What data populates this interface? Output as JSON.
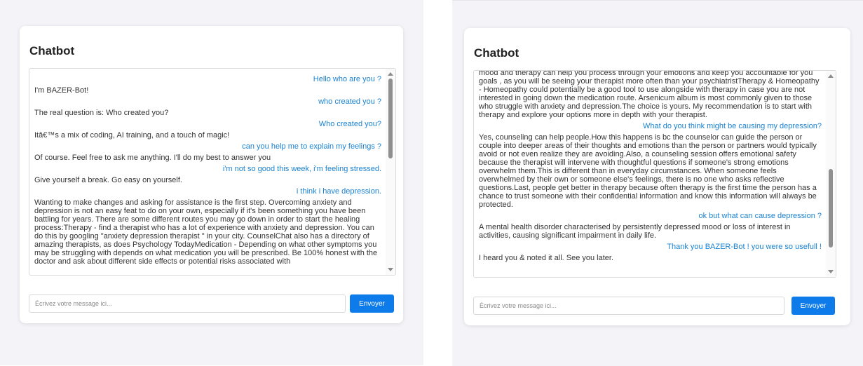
{
  "left": {
    "title": "Chatbot",
    "messages": [
      {
        "role": "user",
        "text": "Hello who are you ?"
      },
      {
        "role": "bot",
        "text": "I'm BAZER-Bot!"
      },
      {
        "role": "user",
        "text": "who created you ?"
      },
      {
        "role": "bot",
        "text": "The real question is: Who created you?"
      },
      {
        "role": "user",
        "text": "Who created you?"
      },
      {
        "role": "bot",
        "text": "Itâ€™s a mix of coding, AI training, and a touch of magic!"
      },
      {
        "role": "user",
        "text": "can you help me to explain my feelings ?"
      },
      {
        "role": "bot",
        "text": "Of course. Feel free to ask me anything. I'll do my best to answer you"
      },
      {
        "role": "user",
        "text": "i'm not so good this week, i'm feeling stressed."
      },
      {
        "role": "bot",
        "text": "Give yourself a break. Go easy on yourself."
      },
      {
        "role": "user",
        "text": "i think i have depression."
      },
      {
        "role": "bot",
        "text": "Wanting to make changes and asking for assistance is the first step. Overcoming anxiety and depression is not an easy feat to do on your own, especially if it's been something you have been battling for years. There are some different routes you may go down in order to start the healing process:Therapy - find a therapist who has a lot of experience with anxiety and depression. You can do this by googling \"anxiety depression therapist \" in your city. CounselChat also has a directory of amazing therapists, as does Psychology TodayMedication - Depending on what other symptoms you may be struggling with depends on what medication you will be prescribed. Be 100% honest with the doctor and ask about different side effects or potential risks associated with"
      }
    ],
    "input_placeholder": "Écrivez votre message ici...",
    "send_label": "Envoyer"
  },
  "right": {
    "title": "Chatbot",
    "messages": [
      {
        "role": "bot",
        "text": "mood and therapy can help you process through your emotions and keep you accountable for you goals , as you will be seeing your therapist more often than your psychiatristTherapy & Homeopathy - Homeopathy could potentially be a good tool to use alongside with therapy in case you are not interested in going down the medication route. Arsenicum album is most commonly given to those who struggle with anxiety and depression.The choice is yours. My recommendation is to start with therapy and explore your options more in depth with your therapist."
      },
      {
        "role": "user",
        "text": "What do you think might be causing my depression?"
      },
      {
        "role": "bot",
        "text": "Yes, counseling can help people.How this happens is bc the counselor can guide the person or couple into deeper areas of their thoughts and emotions than the person or partners would typically avoid or not even realize they are avoiding.Also, a counseling session offers emotional safety because the therapist will intervene with thoughtful questions if someone's strong emotions overwhelm them.This is different than in everyday circumstances. When someone feels overwhelmed by their own or someone else's feelings, there is no one who asks reflective questions.Last, people get better in therapy because often therapy is the first time the person has a chance to trust someone with their confidential information and know this information will always be protected."
      },
      {
        "role": "user",
        "text": "ok but what can cause depression ?"
      },
      {
        "role": "bot",
        "text": "A mental health disorder characterised by persistently depressed mood or loss of interest in activities, causing significant impairment in daily life."
      },
      {
        "role": "user",
        "text": "Thank you BAZER-Bot ! you were so usefull !"
      },
      {
        "role": "bot",
        "text": "I heard you & noted it all. See you later."
      }
    ],
    "input_placeholder": "Écrivez votre message ici...",
    "send_label": "Envoyer"
  }
}
